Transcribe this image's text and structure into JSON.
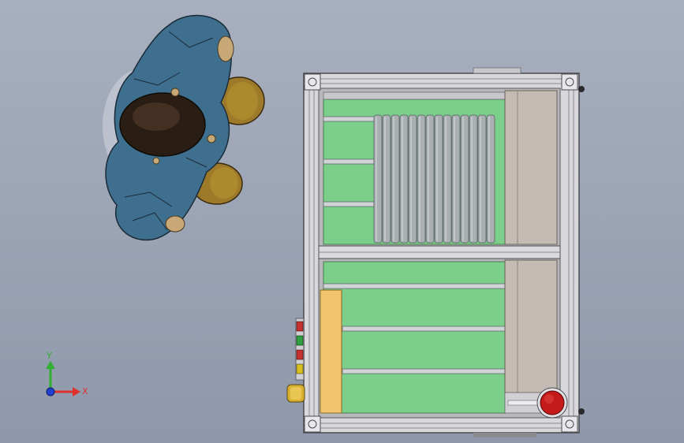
{
  "viewport": {
    "view_orientation": "top",
    "background_colors": [
      "#a8b0bf",
      "#8e98aa"
    ]
  },
  "triad": {
    "x_label": "X",
    "y_label": "Y",
    "x_color": "#e03030",
    "y_color": "#30b030",
    "z_color": "#2040d0"
  },
  "model": {
    "frame_color": "#d8d8dc",
    "panel_color": "#7ccf8a",
    "roller_color": "#aab0b2",
    "side_panel_color": "#c4bcb4",
    "plate_color": "#f2c46e",
    "estop_color": "#c41a1a",
    "operator_colors": {
      "jacket": "#3f6f8e",
      "helmet": "#2a1e14",
      "legs": "#9c7a2a"
    },
    "indicator_lights": [
      "#c83030",
      "#30a040",
      "#c83030",
      "#d8c020"
    ]
  }
}
